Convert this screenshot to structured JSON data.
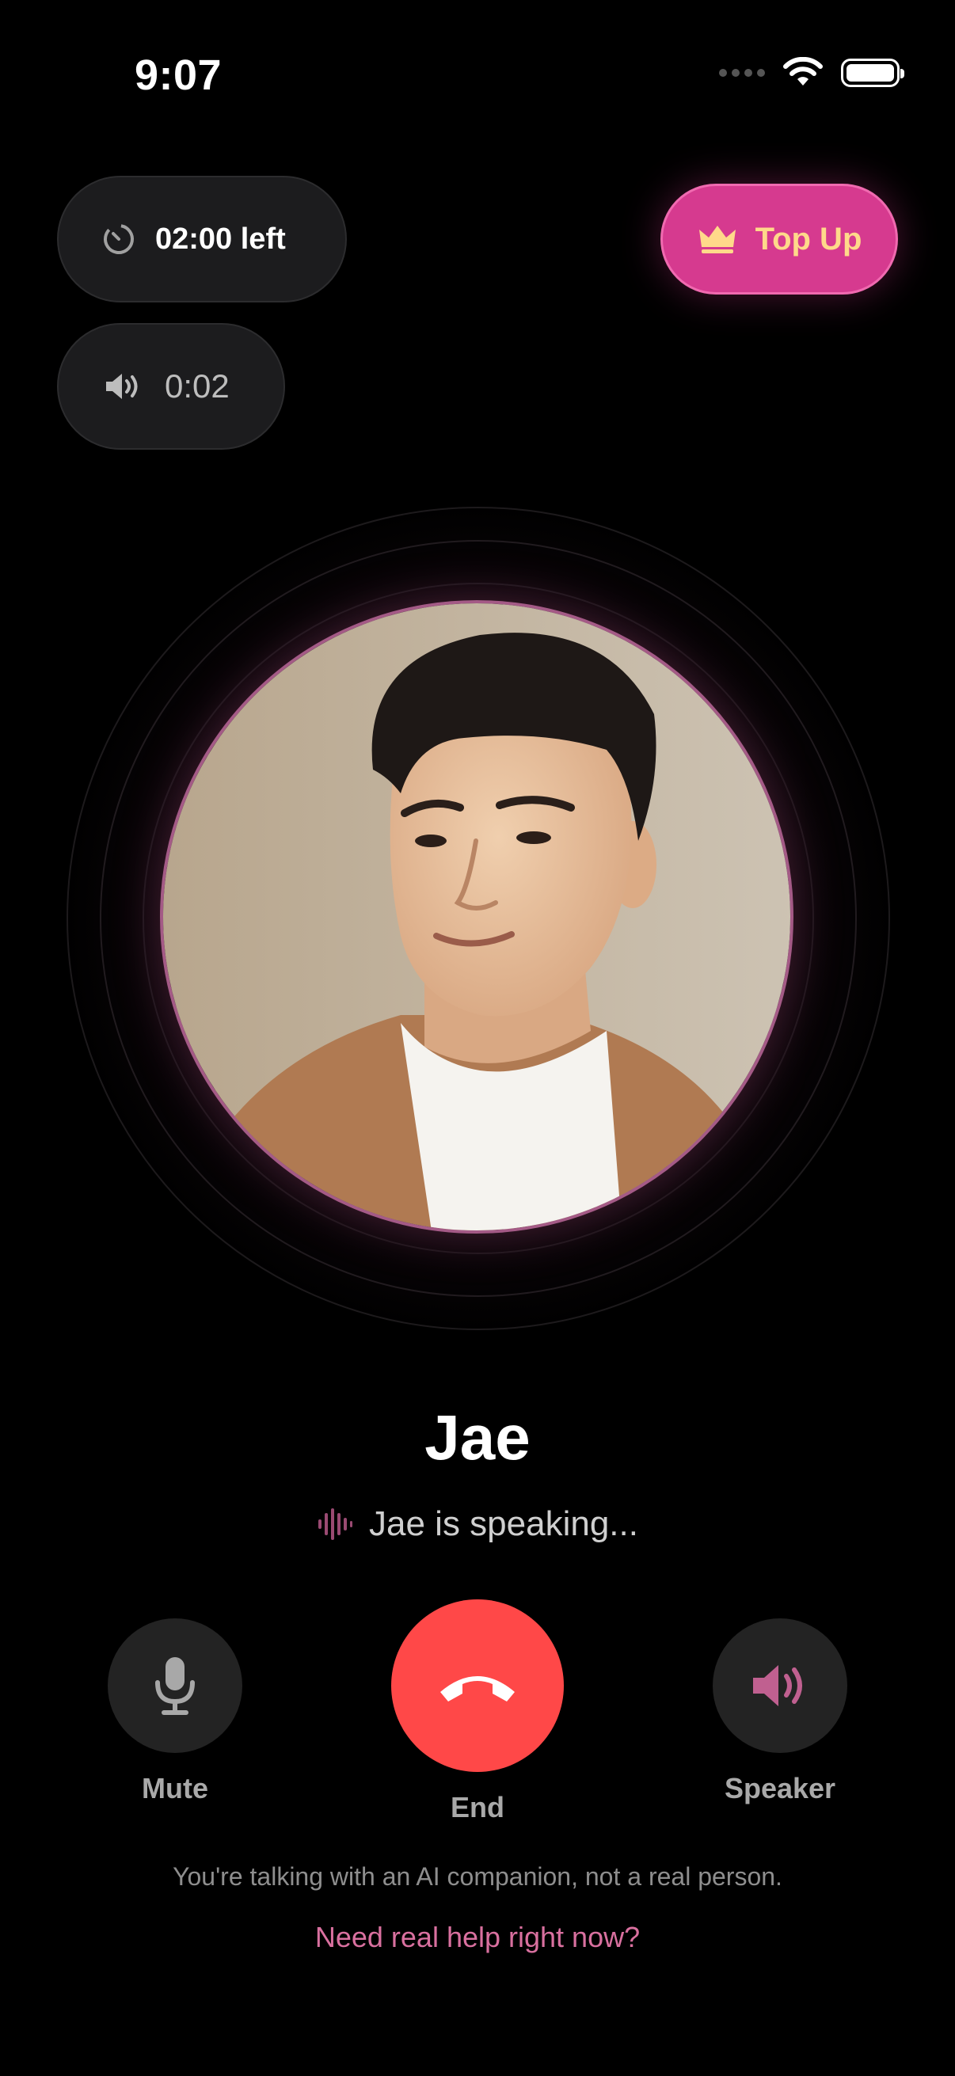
{
  "status_bar": {
    "time": "9:07",
    "icons": [
      "signal-icon",
      "wifi-icon",
      "battery-icon"
    ]
  },
  "call": {
    "time_left": "02:00 left",
    "elapsed": "0:02",
    "top_up_label": "Top Up",
    "contact_name": "Jae",
    "status": "Jae is speaking..."
  },
  "controls": {
    "mute_label": "Mute",
    "end_label": "End",
    "speaker_label": "Speaker"
  },
  "footer": {
    "disclaimer": "You're talking with an AI companion, not a real person.",
    "help_link": "Need real help right now?"
  },
  "colors": {
    "accent_pink": "#d63a8f",
    "top_up_text": "#ffd98a",
    "end_call_red": "#ff4848",
    "help_link": "#d9709f",
    "background": "#000000"
  }
}
